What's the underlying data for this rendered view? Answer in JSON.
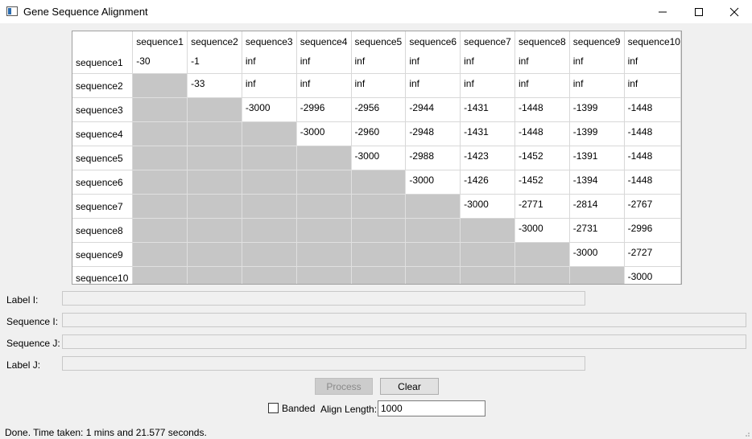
{
  "window": {
    "title": "Gene Sequence Alignment"
  },
  "grid": {
    "columns": [
      "sequence1",
      "sequence2",
      "sequence3",
      "sequence4",
      "sequence5",
      "sequence6",
      "sequence7",
      "sequence8",
      "sequence9",
      "sequence10"
    ],
    "rows": [
      {
        "label": "sequence1",
        "cells": [
          "-30",
          "-1",
          "inf",
          "inf",
          "inf",
          "inf",
          "inf",
          "inf",
          "inf",
          "inf"
        ]
      },
      {
        "label": "sequence2",
        "cells": [
          null,
          "-33",
          "inf",
          "inf",
          "inf",
          "inf",
          "inf",
          "inf",
          "inf",
          "inf"
        ]
      },
      {
        "label": "sequence3",
        "cells": [
          null,
          null,
          "-3000",
          "-2996",
          "-2956",
          "-2944",
          "-1431",
          "-1448",
          "-1399",
          "-1448"
        ]
      },
      {
        "label": "sequence4",
        "cells": [
          null,
          null,
          null,
          "-3000",
          "-2960",
          "-2948",
          "-1431",
          "-1448",
          "-1399",
          "-1448"
        ]
      },
      {
        "label": "sequence5",
        "cells": [
          null,
          null,
          null,
          null,
          "-3000",
          "-2988",
          "-1423",
          "-1452",
          "-1391",
          "-1448"
        ]
      },
      {
        "label": "sequence6",
        "cells": [
          null,
          null,
          null,
          null,
          null,
          "-3000",
          "-1426",
          "-1452",
          "-1394",
          "-1448"
        ]
      },
      {
        "label": "sequence7",
        "cells": [
          null,
          null,
          null,
          null,
          null,
          null,
          "-3000",
          "-2771",
          "-2814",
          "-2767"
        ]
      },
      {
        "label": "sequence8",
        "cells": [
          null,
          null,
          null,
          null,
          null,
          null,
          null,
          "-3000",
          "-2731",
          "-2996"
        ]
      },
      {
        "label": "sequence9",
        "cells": [
          null,
          null,
          null,
          null,
          null,
          null,
          null,
          null,
          "-3000",
          "-2727"
        ]
      },
      {
        "label": "sequence10",
        "cells": [
          null,
          null,
          null,
          null,
          null,
          null,
          null,
          null,
          null,
          "-3000"
        ]
      }
    ]
  },
  "form": {
    "label_i": "Label I:",
    "sequence_i": "Sequence I:",
    "sequence_j": "Sequence J:",
    "label_j": "Label J:"
  },
  "buttons": {
    "process": "Process",
    "clear": "Clear"
  },
  "options": {
    "banded_label": "Banded",
    "banded_checked": false,
    "align_length_label": "Align Length:",
    "align_length_value": "1000"
  },
  "status": {
    "text": "Done.  Time taken: 1 mins and 21.577 seconds."
  },
  "icons": {
    "app": "app-window-icon",
    "minimize": "minimize-icon",
    "maximize": "maximize-icon",
    "close": "close-icon"
  }
}
